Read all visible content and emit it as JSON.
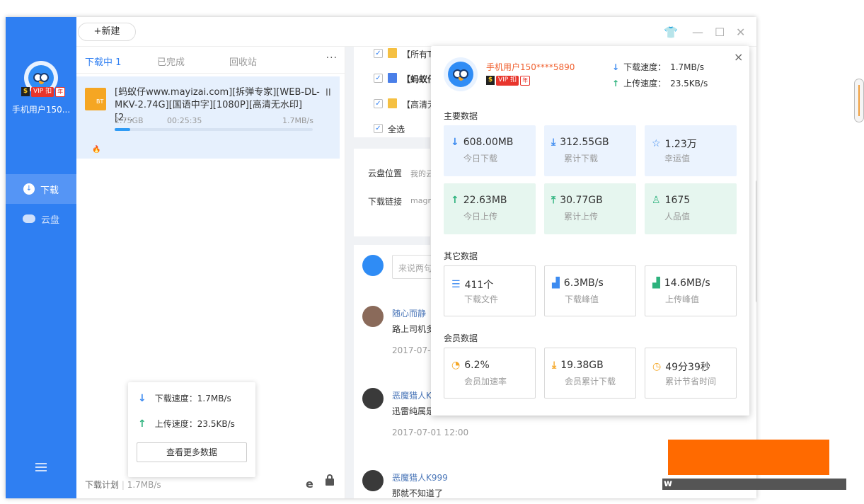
{
  "sidebar": {
    "username": "手机用户150...",
    "vip": {
      "s": "$",
      "label": "VIP 扣",
      "year": "年"
    },
    "nav": [
      {
        "label": "下载"
      },
      {
        "label": "云盘"
      }
    ]
  },
  "topbar": {
    "new_label": "+新建"
  },
  "tabs": {
    "downloading": "下载中",
    "downloading_count": "1",
    "completed": "已完成",
    "recycle": "回收站",
    "more": "···"
  },
  "task": {
    "icon_text": "BT",
    "title": "[蚂蚁仔www.mayizai.com][拆弹专家][WEB-DL-MKV-2.74G][国语中字][1080P][高清无水印][2...",
    "size": "2.75GB",
    "time": "00:25:35",
    "speed": "1.7MB/s",
    "progress": 0.08,
    "pause": "II"
  },
  "bottombar": {
    "plan": "下载计划",
    "speed": "1.7MB/s"
  },
  "speed_popup": {
    "down_label": "下载速度：",
    "down_value": "1.7MB/s",
    "up_label": "上传速度：",
    "up_value": "23.5KB/s",
    "more_button": "查看更多数据"
  },
  "detail": {
    "files": [
      "【所有TV",
      "【蚂蚁仔",
      "【高清无"
    ],
    "select_all": "全选",
    "cloud_location_label": "云盘位置",
    "cloud_location_value": "我的云",
    "download_link_label": "下载链接",
    "download_link_value": "magne",
    "comment_placeholder": "来说两句",
    "comments": [
      {
        "name": "随心而静",
        "text": "路上司机多",
        "time": "2017-07-1"
      },
      {
        "name": "恶魔猎人K",
        "text": "迅雷纯属是",
        "time": "2017-07-01 12:00"
      },
      {
        "name": "恶魔猎人K999",
        "text": "那就不知道了",
        "time": ""
      }
    ]
  },
  "stats": {
    "username": "手机用户150****5890",
    "download_label": "下载速度：",
    "download_value": "1.7MB/s",
    "upload_label": "上传速度：",
    "upload_value": "23.5KB/s",
    "close": "×",
    "main_title": "主要数据",
    "other_title": "其它数据",
    "member_title": "会员数据",
    "main": [
      {
        "icon": "arrow-down-icon",
        "value": "608.00MB",
        "label": "今日下载"
      },
      {
        "icon": "arrow-down-tray-icon",
        "value": "312.55GB",
        "label": "累计下载"
      },
      {
        "icon": "star-icon",
        "value": "1.23万",
        "label": "幸运值"
      },
      {
        "icon": "arrow-up-icon",
        "value": "22.63MB",
        "label": "今日上传"
      },
      {
        "icon": "arrow-up-tray-icon",
        "value": "30.77GB",
        "label": "累计上传"
      },
      {
        "icon": "person-icon",
        "value": "1675",
        "label": "人品值"
      }
    ],
    "other": [
      {
        "icon": "file-list-icon",
        "value": "411个",
        "label": "下载文件"
      },
      {
        "icon": "bar-down-icon",
        "value": "6.3MB/s",
        "label": "下载峰值"
      },
      {
        "icon": "bar-up-icon",
        "value": "14.6MB/s",
        "label": "上传峰值"
      }
    ],
    "member": [
      {
        "icon": "speedometer-icon",
        "value": "6.2%",
        "label": "会员加速率"
      },
      {
        "icon": "download-icon",
        "value": "19.38GB",
        "label": "会员累计下载"
      },
      {
        "icon": "clock-icon",
        "value": "49分39秒",
        "label": "累计节省时间"
      }
    ]
  },
  "colors": {
    "accent": "#2f7ff2",
    "sidebar": "#2f7ff2",
    "green": "#2db27d",
    "orange": "#f5a623",
    "username_red": "#f06130"
  },
  "watermark": {
    "url": "w"
  }
}
